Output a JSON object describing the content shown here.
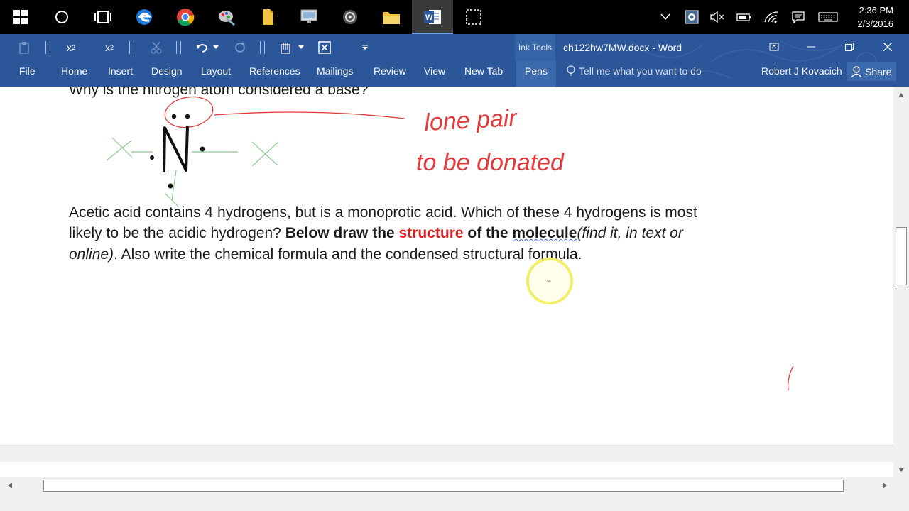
{
  "taskbar": {
    "icons": [
      "windows-start-icon",
      "cortana-circle-icon",
      "task-view-icon",
      "edge-icon",
      "chrome-icon",
      "paint-icon",
      "file-icon",
      "monitor-icon",
      "gear-app-icon",
      "file-explorer-icon",
      "word-icon",
      "snipping-icon"
    ],
    "time": "2:36 PM",
    "date": "2/3/2016"
  },
  "title_bar": {
    "ink_tools": "Ink Tools",
    "document_title": "ch122hw7MW.docx - Word"
  },
  "menu": {
    "tabs": [
      "File",
      "Home",
      "Insert",
      "Design",
      "Layout",
      "References",
      "Mailings",
      "Review",
      "View",
      "New Tab",
      "Pens"
    ],
    "tell_me": "Tell me what you want to do",
    "user": "Robert J Kovacich",
    "share": "Share"
  },
  "document": {
    "line0": "Why is the nitrogen atom considered a base?",
    "line1": "Acetic acid contains 4 hydrogens, but is a monoprotic acid.  Which of these 4 hydrogens is most",
    "line2_a": "likely to be the acidic hydrogen? ",
    "line2_b": "Below draw the ",
    "line2_c": "structure",
    "line2_d": " of the ",
    "line2_e": "molecule",
    "line2_f": "(find it, in text or",
    "line3_a": "online)",
    "line3_b": ". Also write the chemical formula and the condensed structural formula.",
    "handwriting_line1": "lone pair",
    "handwriting_line2": "to be donated"
  },
  "colors": {
    "taskbar": "#000000",
    "ribbon": "#2b579a",
    "accent_red": "#e01e1e",
    "ink_red": "#e23a3a",
    "ink_green": "#8bc88b"
  }
}
